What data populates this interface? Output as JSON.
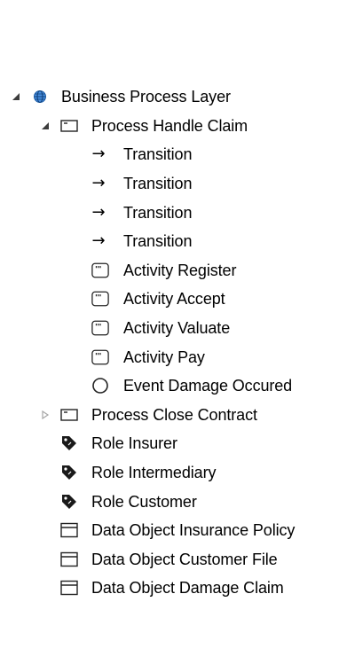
{
  "tree": {
    "root": {
      "label": "Business Process Layer",
      "expanded": true,
      "icon": "globe-icon"
    },
    "process_handle_claim": {
      "label": "Process Handle Claim",
      "expanded": true,
      "icon": "process-icon",
      "children": [
        {
          "label": "Transition",
          "icon": "arrow-right-icon"
        },
        {
          "label": "Transition",
          "icon": "arrow-right-icon"
        },
        {
          "label": "Transition",
          "icon": "arrow-right-icon"
        },
        {
          "label": "Transition",
          "icon": "arrow-right-icon"
        },
        {
          "label": "Activity Register",
          "icon": "activity-icon"
        },
        {
          "label": "Activity Accept",
          "icon": "activity-icon"
        },
        {
          "label": "Activity Valuate",
          "icon": "activity-icon"
        },
        {
          "label": "Activity Pay",
          "icon": "activity-icon"
        },
        {
          "label": "Event Damage Occured",
          "icon": "event-circle-icon"
        }
      ]
    },
    "process_close_contract": {
      "label": "Process Close Contract",
      "expanded": false,
      "icon": "process-icon"
    },
    "roles": [
      {
        "label": "Role Insurer",
        "icon": "role-tag-icon"
      },
      {
        "label": "Role Intermediary",
        "icon": "role-tag-icon"
      },
      {
        "label": "Role Customer",
        "icon": "role-tag-icon"
      }
    ],
    "data_objects": [
      {
        "label": "Data Object Insurance Policy",
        "icon": "data-object-icon"
      },
      {
        "label": "Data Object Customer File",
        "icon": "data-object-icon"
      },
      {
        "label": "Data Object Damage Claim",
        "icon": "data-object-icon"
      }
    ]
  },
  "colors": {
    "globe": "#1f6fc9",
    "expander": "#3c3c3c",
    "expander_collapsed": "#a6a6a6",
    "icon_stroke": "#222222"
  }
}
